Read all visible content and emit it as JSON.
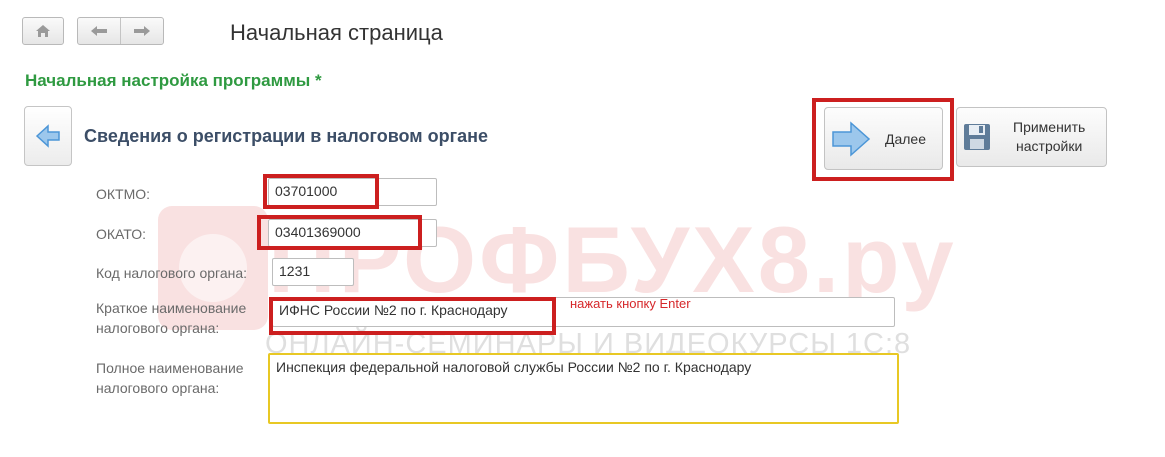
{
  "nav": {
    "home_icon": "home-icon",
    "back_icon": "arrow-left-icon",
    "forward_icon": "arrow-right-icon"
  },
  "page_title": "Начальная страница",
  "section_title": "Начальная настройка программы *",
  "form_title": "Сведения о регистрации в налоговом органе",
  "buttons": {
    "next_label": "Далее",
    "apply_label_line1": "Применить",
    "apply_label_line2": "настройки"
  },
  "fields": {
    "oktmo": {
      "label": "ОКТМО:",
      "value": "03701000"
    },
    "okato": {
      "label": "ОКАТО:",
      "value": "03401369000"
    },
    "tax_code": {
      "label": "Код налогового органа:",
      "value": "1231"
    },
    "short_name": {
      "label_line1": "Краткое наименование",
      "label_line2": "налогового органа:",
      "value": "ИФНС России №2 по г. Краснодару"
    },
    "full_name": {
      "label_line1": "Полное наименование",
      "label_line2": "налогового органа:",
      "value": "Инспекция федеральной налоговой службы России №2 по г. Краснодару"
    }
  },
  "annotation": "нажать кнопку Enter",
  "watermark": {
    "main": "ПРОФБУХ8.ру",
    "sub": "ОНЛАЙН-СЕМИНАРЫ И ВИДЕОКУРСЫ 1С:8"
  },
  "colors": {
    "accent_green": "#2f9a41",
    "title_blue": "#3c4e67",
    "highlight_red": "#cc1f1f",
    "field_yellow": "#e8c824",
    "arrow_blue": "#4c96d7"
  }
}
